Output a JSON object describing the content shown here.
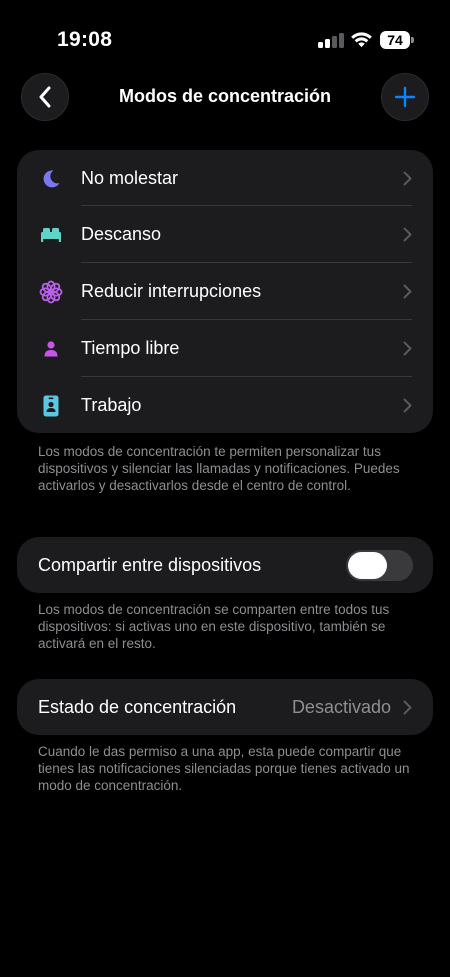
{
  "status_bar": {
    "time": "19:08",
    "battery": "74"
  },
  "nav": {
    "title": "Modos de concentración",
    "back_icon": "chevron-left-icon",
    "add_icon": "plus-icon"
  },
  "modes": [
    {
      "label": "No molestar",
      "icon": "moon-icon",
      "color": "#7a78f0"
    },
    {
      "label": "Descanso",
      "icon": "bed-icon",
      "color": "#5fd3c8"
    },
    {
      "label": "Reducir interrupciones",
      "icon": "flower-icon",
      "color": "#b860e8"
    },
    {
      "label": "Tiempo libre",
      "icon": "person-icon",
      "color": "#c955e6"
    },
    {
      "label": "Trabajo",
      "icon": "id-badge-icon",
      "color": "#5ac8e4"
    }
  ],
  "modes_footnote": "Los modos de concentración te permiten personalizar tus dispositivos y silenciar las llamadas y notificaciones. Puedes activarlos y desactivarlos desde el centro de control.",
  "share": {
    "label": "Compartir entre dispositivos",
    "enabled": false,
    "footnote": "Los modos de concentración se comparten entre todos tus dispositivos: si activas uno en este dispositivo, también se activará en el resto."
  },
  "focus_status": {
    "label": "Estado de concentración",
    "value": "Desactivado",
    "footnote": "Cuando le das permiso a una app, esta puede compartir que tienes las notificaciones silenciadas porque tienes activado un modo de concentración."
  },
  "colors": {
    "accent": "#0a84ff",
    "chevron": "#5a5a5e",
    "secondary_text": "#8e8e93"
  }
}
